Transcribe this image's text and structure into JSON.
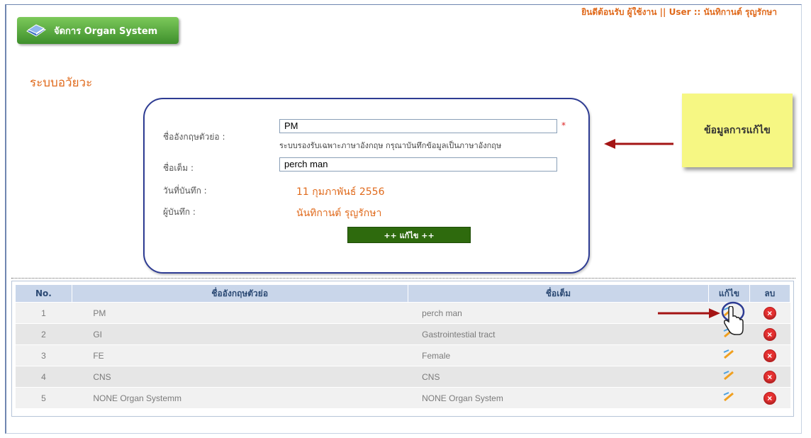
{
  "header": {
    "welcome_text": "ยินดีต้อนรับ ผู้ใช้งาน || User :: นันทิกานต์ รุญรักษา",
    "title_button_label": "จัดการ Organ System"
  },
  "page": {
    "heading": "ระบบอวัยวะ"
  },
  "form": {
    "abbr_label": "ชื่ออังกฤษตัวย่อ :",
    "abbr_value": "PM",
    "required_mark": "*",
    "abbr_hint": "ระบบรองรับเฉพาะภาษาอังกฤษ กรุณาบันทึกข้อมูลเป็นภาษาอังกฤษ",
    "full_label": "ชื่อเต็ม :",
    "full_value": "perch man",
    "date_label": "วันที่บันทึก :",
    "date_value": "11 กุมภาพันธ์ 2556",
    "recorder_label": "ผู้บันทึก :",
    "recorder_value": "นันทิกานต์ รุญรักษา",
    "edit_button_label": "++ แก้ไข ++"
  },
  "annotation": {
    "note_text": "ข้อมูลการแก้ไข"
  },
  "table": {
    "headers": [
      "No.",
      "ชื่ออังกฤษตัวย่อ",
      "ชื่อเต็ม",
      "แก้ไข",
      "ลบ"
    ],
    "rows": [
      {
        "no": "1",
        "abbr": "PM",
        "full": "perch man"
      },
      {
        "no": "2",
        "abbr": "GI",
        "full": "Gastrointestial tract"
      },
      {
        "no": "3",
        "abbr": "FE",
        "full": "Female"
      },
      {
        "no": "4",
        "abbr": "CNS",
        "full": "CNS"
      },
      {
        "no": "5",
        "abbr": "NONE Organ Systemm",
        "full": "NONE Organ System"
      }
    ]
  },
  "icons": {
    "title": "book-icon",
    "edit": "pencil-icon",
    "delete": "delete-icon",
    "cursor": "hand-cursor-icon"
  },
  "colors": {
    "accent_orange": "#e06a1c",
    "title_green": "#4ea436",
    "button_green": "#2e6a0d",
    "form_border": "#2e3c93",
    "note_yellow": "#f6f783",
    "arrow_red": "#a41414",
    "header_blue": "#c9d6ea"
  }
}
